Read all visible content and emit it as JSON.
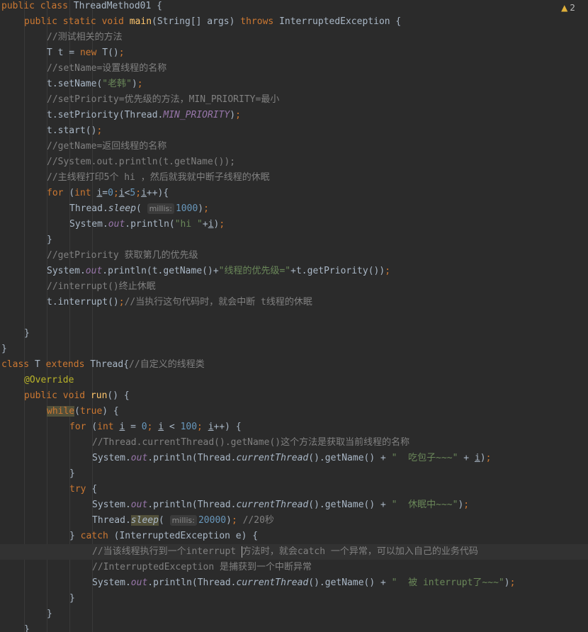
{
  "editor": {
    "warning_count": "2",
    "warning_icon": "warning-triangle-icon",
    "lines": [
      {
        "indent": 0,
        "tokens": [
          [
            "kw",
            "public class "
          ],
          [
            "",
            "ThreadMethod01 {"
          ]
        ]
      },
      {
        "indent": 1,
        "tokens": [
          [
            "kw",
            "public static void "
          ],
          [
            "fn",
            "main"
          ],
          [
            "",
            "(String[] args) "
          ],
          [
            "kw",
            "throws "
          ],
          [
            "",
            "InterruptedException {"
          ]
        ]
      },
      {
        "indent": 2,
        "tokens": [
          [
            "cm",
            "//测试相关的方法"
          ]
        ]
      },
      {
        "indent": 2,
        "tokens": [
          [
            "",
            "T t = "
          ],
          [
            "kw",
            "new "
          ],
          [
            "",
            "T()"
          ],
          [
            "kw",
            ";"
          ]
        ]
      },
      {
        "indent": 2,
        "tokens": [
          [
            "cm",
            "//setName=设置线程的名称"
          ]
        ]
      },
      {
        "indent": 2,
        "tokens": [
          [
            "",
            "t.setName("
          ],
          [
            "str",
            "\"老韩\""
          ],
          [
            "",
            ")"
          ],
          [
            "kw",
            ";"
          ]
        ]
      },
      {
        "indent": 2,
        "tokens": [
          [
            "cm",
            "//setPriority=优先级的方法，MIN_PRIORITY=最小"
          ]
        ]
      },
      {
        "indent": 2,
        "tokens": [
          [
            "",
            "t.setPriority(Thread."
          ],
          [
            "st",
            "MIN_PRIORITY"
          ],
          [
            "",
            ")"
          ],
          [
            "kw",
            ";"
          ]
        ]
      },
      {
        "indent": 2,
        "tokens": [
          [
            "",
            "t.start()"
          ],
          [
            "kw",
            ";"
          ]
        ]
      },
      {
        "indent": 2,
        "tokens": [
          [
            "cm",
            "//getName=返回线程的名称"
          ]
        ]
      },
      {
        "indent": 2,
        "tokens": [
          [
            "cm",
            "//System.out.println(t.getName());"
          ]
        ]
      },
      {
        "indent": 2,
        "tokens": [
          [
            "cm",
            "//主线程打印5个 hi ，然后就我就中断子线程的休眠"
          ]
        ]
      },
      {
        "indent": 2,
        "tokens": [
          [
            "kw",
            "for "
          ],
          [
            "",
            "("
          ],
          [
            "kw",
            "int "
          ],
          [
            "ul",
            "i"
          ],
          [
            "",
            "="
          ],
          [
            "num",
            "0"
          ],
          [
            "kw",
            ";"
          ],
          [
            "ul",
            "i"
          ],
          [
            "",
            "<"
          ],
          [
            "num",
            "5"
          ],
          [
            "kw",
            ";"
          ],
          [
            "ul",
            "i"
          ],
          [
            "",
            "++){"
          ]
        ]
      },
      {
        "indent": 3,
        "tokens": [
          [
            "",
            "Thread."
          ],
          [
            "it",
            "sleep"
          ],
          [
            "",
            "( "
          ],
          [
            "hint",
            "millis:"
          ],
          [
            "num",
            "1000"
          ],
          [
            "",
            ")"
          ],
          [
            "kw",
            ";"
          ]
        ]
      },
      {
        "indent": 3,
        "tokens": [
          [
            "",
            "System."
          ],
          [
            "st",
            "out"
          ],
          [
            "",
            ".println("
          ],
          [
            "str",
            "\"hi \""
          ],
          [
            "",
            "+"
          ],
          [
            "ul",
            "i"
          ],
          [
            "",
            ")"
          ],
          [
            "kw",
            ";"
          ]
        ]
      },
      {
        "indent": 2,
        "tokens": [
          [
            "",
            "}"
          ]
        ]
      },
      {
        "indent": 2,
        "tokens": [
          [
            "cm",
            "//getPriority 获取第几的优先级"
          ]
        ]
      },
      {
        "indent": 2,
        "tokens": [
          [
            "",
            "System."
          ],
          [
            "st",
            "out"
          ],
          [
            "",
            ".println(t.getName()+"
          ],
          [
            "str",
            "\"线程的优先级=\""
          ],
          [
            "",
            "+t.getPriority())"
          ],
          [
            "kw",
            ";"
          ]
        ]
      },
      {
        "indent": 2,
        "tokens": [
          [
            "cm",
            "//interrupt()终止休眠"
          ]
        ]
      },
      {
        "indent": 2,
        "tokens": [
          [
            "",
            "t.interrupt()"
          ],
          [
            "kw",
            ";"
          ],
          [
            "cm",
            "//当执行这句代码时，就会中断 t线程的休眠"
          ]
        ]
      },
      {
        "indent": 0,
        "tokens": []
      },
      {
        "indent": 1,
        "tokens": [
          [
            "",
            "}"
          ]
        ]
      },
      {
        "indent": 0,
        "tokens": [
          [
            "",
            "}"
          ]
        ]
      },
      {
        "indent": 0,
        "tokens": [
          [
            "kw",
            "class "
          ],
          [
            "",
            "T "
          ],
          [
            "kw",
            "extends "
          ],
          [
            "",
            "Thread{"
          ],
          [
            "cm",
            "//自定义的线程类"
          ]
        ]
      },
      {
        "indent": 1,
        "tokens": [
          [
            "ann",
            "@Override"
          ]
        ]
      },
      {
        "indent": 1,
        "tokens": [
          [
            "kw",
            "public void "
          ],
          [
            "fn",
            "run"
          ],
          [
            "",
            "() {"
          ]
        ]
      },
      {
        "indent": 2,
        "tokens": [
          [
            "kw hl2",
            "while"
          ],
          [
            "",
            "("
          ],
          [
            "kw",
            "true"
          ],
          [
            "",
            ") {"
          ]
        ]
      },
      {
        "indent": 3,
        "tokens": [
          [
            "kw",
            "for "
          ],
          [
            "",
            "("
          ],
          [
            "kw",
            "int "
          ],
          [
            "ul",
            "i"
          ],
          [
            "",
            " = "
          ],
          [
            "num",
            "0"
          ],
          [
            "kw",
            "; "
          ],
          [
            "ul",
            "i"
          ],
          [
            "",
            ""
          ],
          [
            "",
            " < "
          ],
          [
            "num",
            "100"
          ],
          [
            "kw",
            "; "
          ],
          [
            "ul",
            "i"
          ],
          [
            "",
            "++) {"
          ]
        ]
      },
      {
        "indent": 4,
        "tokens": [
          [
            "cm",
            "//Thread.currentThread().getName()这个方法是获取当前线程的名称"
          ]
        ]
      },
      {
        "indent": 4,
        "tokens": [
          [
            "",
            "System."
          ],
          [
            "st",
            "out"
          ],
          [
            "",
            ".println(Thread."
          ],
          [
            "it",
            "currentThread"
          ],
          [
            "",
            "().getName() + "
          ],
          [
            "str",
            "\"  吃包子~~~\""
          ],
          [
            "",
            " + "
          ],
          [
            "ul",
            "i"
          ],
          [
            "",
            ")"
          ],
          [
            "kw",
            ";"
          ]
        ]
      },
      {
        "indent": 3,
        "tokens": [
          [
            "",
            "}"
          ]
        ]
      },
      {
        "indent": 3,
        "tokens": [
          [
            "kw",
            "try "
          ],
          [
            "",
            "{"
          ]
        ]
      },
      {
        "indent": 4,
        "tokens": [
          [
            "",
            "System."
          ],
          [
            "st",
            "out"
          ],
          [
            "",
            ".println(Thread."
          ],
          [
            "it",
            "currentThread"
          ],
          [
            "",
            "().getName() + "
          ],
          [
            "str",
            "\"  休眠中~~~\""
          ],
          [
            "",
            ")"
          ],
          [
            "kw",
            ";"
          ]
        ]
      },
      {
        "indent": 4,
        "tokens": [
          [
            "",
            "Thread."
          ],
          [
            "it hl2",
            "sleep"
          ],
          [
            "",
            "( "
          ],
          [
            "hint",
            "millis:"
          ],
          [
            "num",
            "20000"
          ],
          [
            "",
            ")"
          ],
          [
            "kw",
            "; "
          ],
          [
            "cm",
            "//20秒"
          ]
        ]
      },
      {
        "indent": 3,
        "tokens": [
          [
            "",
            "} "
          ],
          [
            "kw",
            "catch "
          ],
          [
            "",
            "(InterruptedException e) {"
          ]
        ]
      },
      {
        "indent": 4,
        "current": true,
        "tokens": [
          [
            "cm",
            "//当该线程执行到一个interrupt "
          ],
          [
            "caret",
            ""
          ],
          [
            "cm",
            "方法时，就会catch 一个异常，可以加入自己的业务代码"
          ]
        ]
      },
      {
        "indent": 4,
        "tokens": [
          [
            "cm",
            "//InterruptedException 是捕获到一个中断异常"
          ]
        ]
      },
      {
        "indent": 4,
        "tokens": [
          [
            "",
            "System."
          ],
          [
            "st",
            "out"
          ],
          [
            "",
            ".println(Thread."
          ],
          [
            "it",
            "currentThread"
          ],
          [
            "",
            "().getName() + "
          ],
          [
            "str",
            "\"  被 interrupt了~~~\""
          ],
          [
            "",
            ")"
          ],
          [
            "kw",
            ";"
          ]
        ]
      },
      {
        "indent": 3,
        "tokens": [
          [
            "",
            "}"
          ]
        ]
      },
      {
        "indent": 2,
        "tokens": [
          [
            "",
            "}"
          ]
        ]
      },
      {
        "indent": 1,
        "tokens": [
          [
            "",
            "}"
          ]
        ]
      }
    ]
  }
}
